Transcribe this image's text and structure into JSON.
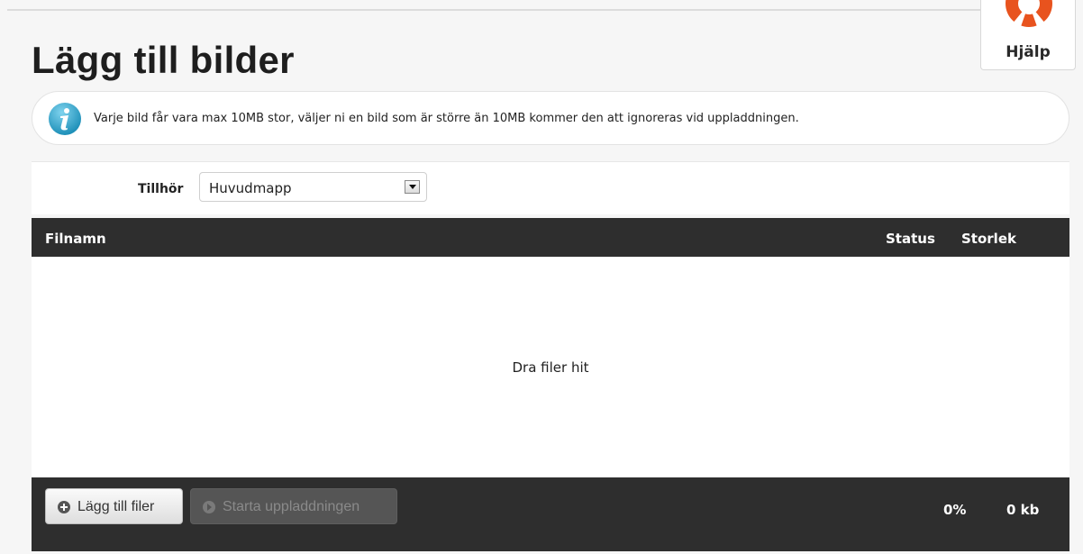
{
  "page": {
    "title": "Lägg till bilder"
  },
  "help": {
    "label": "Hjälp",
    "icon": "lifebuoy-icon",
    "accent_color": "#e8531e"
  },
  "info": {
    "icon": "info-icon",
    "icon_color": "#2a9fc6",
    "text": "Varje bild får vara max 10MB stor, väljer ni en bild som är större än 10MB kommer den att ignoreras vid uppladdningen."
  },
  "folder": {
    "label": "Tillhör",
    "selected": "Huvudmapp"
  },
  "table": {
    "columns": {
      "filename": "Filnamn",
      "status": "Status",
      "size": "Storlek"
    },
    "drop_text": "Dra filer hit"
  },
  "footer": {
    "add_files_label": "Lägg till filer",
    "start_upload_label": "Starta uppladdningen",
    "start_upload_enabled": false,
    "percent": "0%",
    "total_size": "0 kb"
  }
}
